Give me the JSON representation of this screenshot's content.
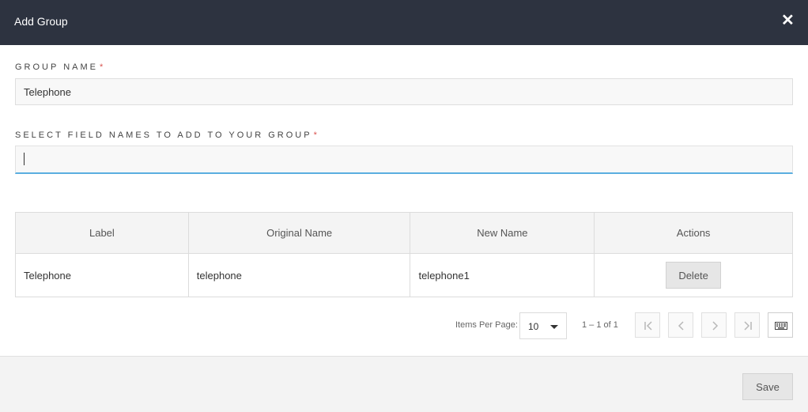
{
  "dialog": {
    "title": "Add Group",
    "close_icon": "close-icon"
  },
  "group_name": {
    "label": "GROUP NAME",
    "required_mark": "*",
    "value": "Telephone"
  },
  "field_select": {
    "label": "SELECT FIELD NAMES TO ADD TO YOUR GROUP",
    "required_mark": "*",
    "value": ""
  },
  "table": {
    "columns": [
      "Label",
      "Original Name",
      "New Name",
      "Actions"
    ],
    "rows": [
      {
        "label": "Telephone",
        "original_name": "telephone",
        "new_name": "telephone1",
        "action_label": "Delete"
      }
    ]
  },
  "pagination": {
    "items_per_page_label": "Items Per Page:",
    "items_per_page": "10",
    "range": "1 – 1 of 1",
    "icons": [
      "first-page-icon",
      "previous-page-icon",
      "next-page-icon",
      "last-page-icon",
      "keyboard-icon"
    ]
  },
  "footer": {
    "save_label": "Save"
  },
  "colors": {
    "header_bg": "#2d3340",
    "focus_accent": "#5aaee0",
    "required": "#d9534f"
  }
}
